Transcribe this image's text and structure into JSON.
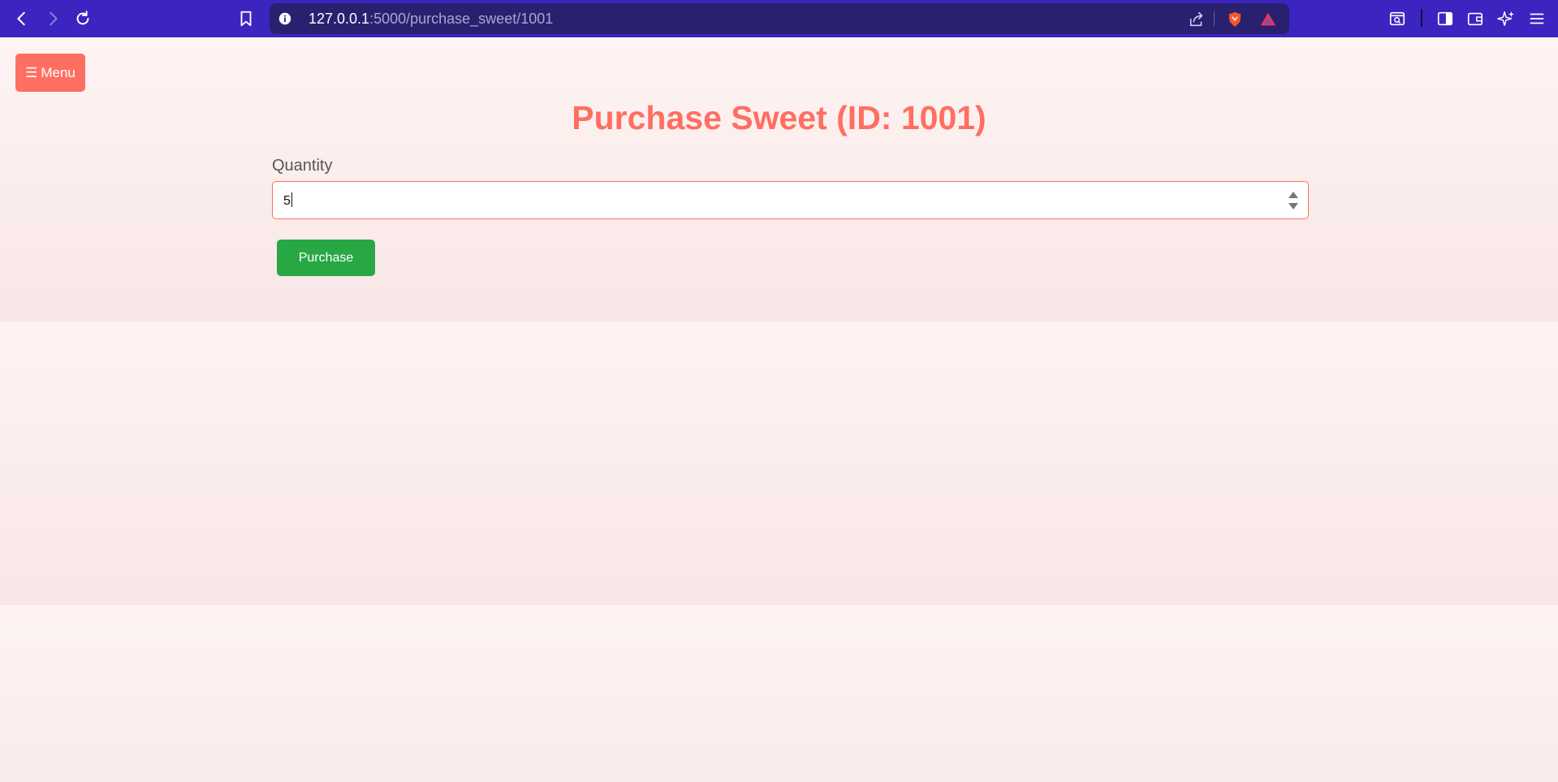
{
  "browser": {
    "url_host": "127.0.0.1",
    "url_path": ":5000/purchase_sweet/1001"
  },
  "page": {
    "menu_icon": "☰",
    "menu_label": "Menu",
    "title": "Purchase Sweet (ID: 1001)",
    "quantity_label": "Quantity",
    "quantity_value": "5",
    "purchase_label": "Purchase"
  },
  "colors": {
    "chrome": "#3c24c0",
    "urlbar": "#2a2070",
    "accent": "#ff6f61",
    "button_green": "#28a745",
    "background": "#fdf2f2"
  },
  "icons": [
    "back-icon",
    "forward-icon",
    "reload-icon",
    "bookmark-icon",
    "info-icon",
    "share-icon",
    "brave-shield-icon",
    "brave-rewards-icon",
    "search-tab-icon",
    "sidebar-icon",
    "wallet-icon",
    "leo-ai-icon",
    "hamburger-menu-icon"
  ]
}
